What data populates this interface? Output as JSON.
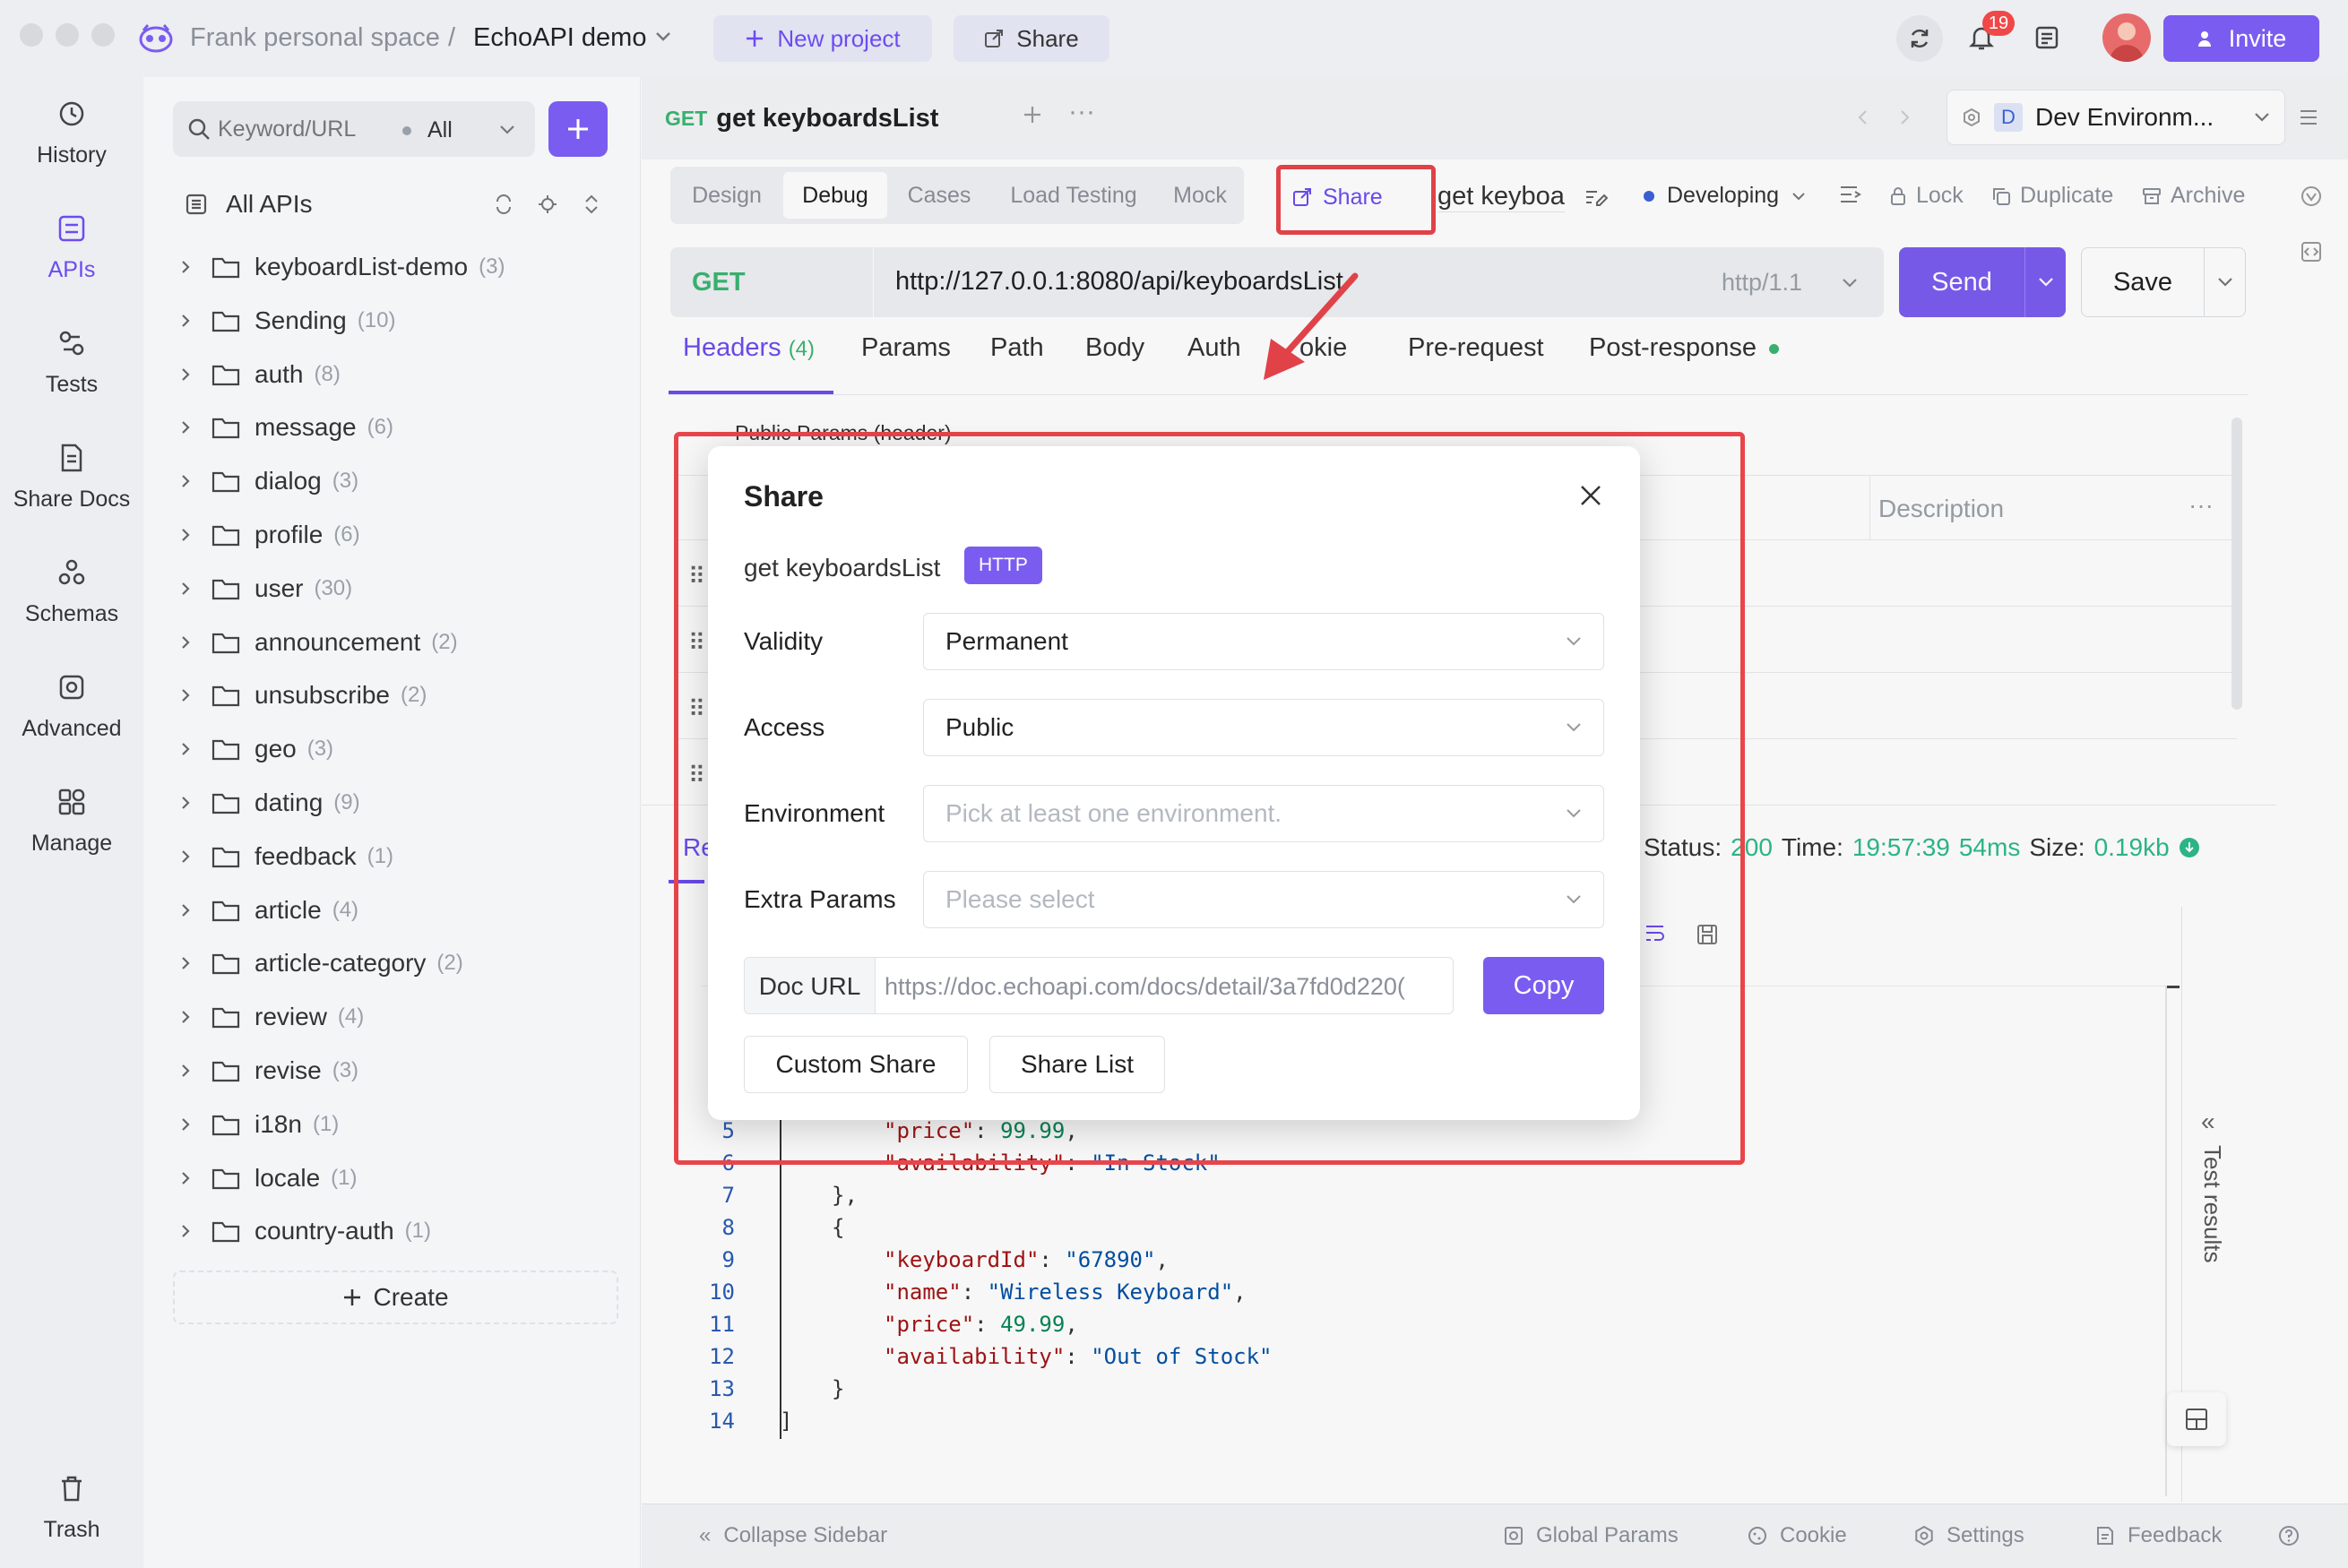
{
  "window": {
    "breadcrumb_space": "Frank personal space",
    "breadcrumb_sep": "/",
    "breadcrumb_project": "EchoAPI demo",
    "new_project_label": "New project",
    "share_label": "Share",
    "notification_count": "19",
    "invite_label": "Invite"
  },
  "rail": {
    "items": [
      {
        "label": "History",
        "icon": "history-icon"
      },
      {
        "label": "APIs",
        "icon": "apis-icon"
      },
      {
        "label": "Tests",
        "icon": "tests-icon"
      },
      {
        "label": "Share Docs",
        "icon": "share-docs-icon"
      },
      {
        "label": "Schemas",
        "icon": "schemas-icon"
      },
      {
        "label": "Advanced",
        "icon": "advanced-icon"
      },
      {
        "label": "Manage",
        "icon": "manage-icon"
      }
    ],
    "trash_label": "Trash"
  },
  "sidebar": {
    "search_placeholder": "Keyword/URL",
    "filter_label": "All",
    "all_apis_label": "All APIs",
    "folders": [
      {
        "name": "keyboardList-demo",
        "count": "(3)"
      },
      {
        "name": "Sending",
        "count": "(10)"
      },
      {
        "name": "auth",
        "count": "(8)"
      },
      {
        "name": "message",
        "count": "(6)"
      },
      {
        "name": "dialog",
        "count": "(3)"
      },
      {
        "name": "profile",
        "count": "(6)"
      },
      {
        "name": "user",
        "count": "(30)"
      },
      {
        "name": "announcement",
        "count": "(2)"
      },
      {
        "name": "unsubscribe",
        "count": "(2)"
      },
      {
        "name": "geo",
        "count": "(3)"
      },
      {
        "name": "dating",
        "count": "(9)"
      },
      {
        "name": "feedback",
        "count": "(1)"
      },
      {
        "name": "article",
        "count": "(4)"
      },
      {
        "name": "article-category",
        "count": "(2)"
      },
      {
        "name": "review",
        "count": "(4)"
      },
      {
        "name": "revise",
        "count": "(3)"
      },
      {
        "name": "i18n",
        "count": "(1)"
      },
      {
        "name": "locale",
        "count": "(1)"
      },
      {
        "name": "country-auth",
        "count": "(1)"
      }
    ],
    "create_label": "Create"
  },
  "editor": {
    "tab_method": "GET",
    "tab_title": "get keyboardsList",
    "environment": "Dev Environm...",
    "env_badge": "D",
    "modes": [
      "Design",
      "Debug",
      "Cases",
      "Load Testing",
      "Mock"
    ],
    "share_label": "Share",
    "api_name_field": "get keyboa",
    "status_label": "Developing",
    "lock_label": "Lock",
    "duplicate_label": "Duplicate",
    "archive_label": "Archive",
    "method": "GET",
    "url": "http://127.0.0.1:8080/api/keyboardsList",
    "http_version": "http/1.1",
    "send_label": "Send",
    "save_label": "Save",
    "request_tabs": {
      "headers": "Headers",
      "headers_count": "(4)",
      "params": "Params",
      "path": "Path",
      "body": "Body",
      "auth": "Auth",
      "cookie": "okie",
      "pre_request": "Pre-request",
      "post_response": "Post-response"
    },
    "public_params_label": "Public Params  (header)",
    "description_header": "Description",
    "response_tab_partial": "Re",
    "status_label_text": "Status:",
    "status_value": "200",
    "time_label": "Time:",
    "time_value": "19:57:39",
    "duration_value": "54ms",
    "size_label": "Size:",
    "size_value": "0.19kb",
    "test_results_label": "Test results"
  },
  "code": {
    "line_numbers": [
      "5",
      "6",
      "7",
      "8",
      "9",
      "10",
      "11",
      "12",
      "13",
      "14"
    ],
    "l5_key": "\"price\"",
    "l5_val": "99.99",
    "l6_key": "\"availability\"",
    "l6_val": "\"In Stock\"",
    "l7": "},",
    "l8": "{",
    "l9_key": "\"keyboardId\"",
    "l9_val": "\"67890\"",
    "l10_key": "\"name\"",
    "l10_val": "\"Wireless Keyboard\"",
    "l11_key": "\"price\"",
    "l11_val": "49.99",
    "l12_key": "\"availability\"",
    "l12_val": "\"Out of Stock\"",
    "l13": "}",
    "l14": "]"
  },
  "bottombar": {
    "collapse_label": "Collapse Sidebar",
    "global_params_label": "Global Params",
    "cookie_label": "Cookie",
    "settings_label": "Settings",
    "feedback_label": "Feedback"
  },
  "modal": {
    "title": "Share",
    "api_name": "get keyboardsList",
    "protocol_badge": "HTTP",
    "validity_label": "Validity",
    "validity_value": "Permanent",
    "access_label": "Access",
    "access_value": "Public",
    "environment_label": "Environment",
    "environment_placeholder": "Pick at least one environment.",
    "extra_params_label": "Extra Params",
    "extra_params_placeholder": "Please select",
    "doc_url_label": "Doc URL",
    "doc_url_value": "https://doc.echoapi.com/docs/detail/3a7fd0d220(",
    "copy_label": "Copy",
    "custom_share_label": "Custom Share",
    "share_list_label": "Share List"
  },
  "colors": {
    "accent": "#7b5cf0",
    "highlight": "#e8454b",
    "success": "#2dba8a",
    "method": "#3bb572"
  }
}
